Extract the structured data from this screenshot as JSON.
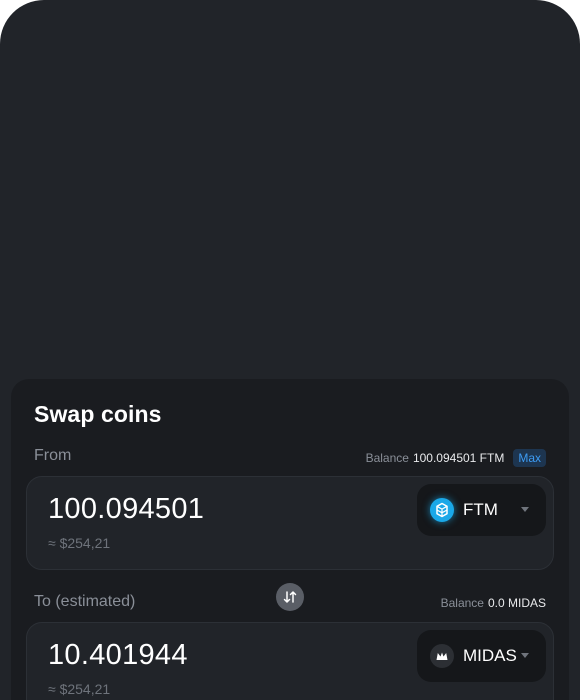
{
  "swap": {
    "title": "Swap coins",
    "from": {
      "label": "From",
      "balance_label": "Balance",
      "balance_value": "100.094501 FTM",
      "max_label": "Max",
      "amount": "100.094501",
      "fiat": "≈ $254,21",
      "token": "FTM",
      "token_icon": "fantom-icon"
    },
    "to": {
      "label": "To (estimated)",
      "balance_label": "Balance",
      "balance_value": "0.0 MIDAS",
      "amount": "10.401944",
      "fiat": "≈ $254,21",
      "token": "MIDAS",
      "token_icon": "midas-icon"
    },
    "swap_direction_icon": "swap-arrows-icon"
  },
  "colors": {
    "background": "#212429",
    "panel": "#1a1c20",
    "accent": "#3d9bf2",
    "ftm": "#1aa8e8"
  }
}
